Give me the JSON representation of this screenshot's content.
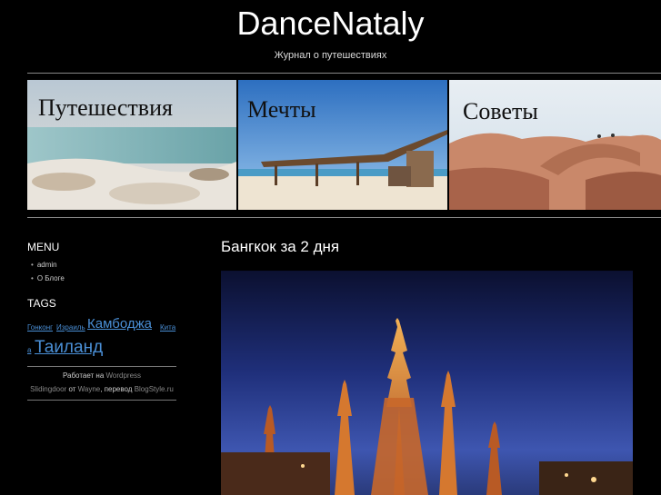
{
  "site": {
    "title": "DanceNataly",
    "tagline": "Журнал о путешествиях"
  },
  "banners": [
    {
      "label": "Путешествия"
    },
    {
      "label": "Мечты"
    },
    {
      "label": "Советы"
    }
  ],
  "sidebar": {
    "menu_heading": "MENU",
    "menu_items": [
      "admin",
      "О Блоге"
    ],
    "tags_heading": "TAGS",
    "tags": [
      "Гонконг",
      "Израиль",
      "Камбоджа",
      "Кита",
      "а",
      "Таиланд"
    ],
    "credits": {
      "powered_prefix": "Работает на",
      "powered_link": "Wordpress",
      "theme_link": "Slidingdoor",
      "from": "от",
      "author_link": "Wayne",
      "translation": ", перевод",
      "translator_link": "BlogStyle.ru"
    }
  },
  "post": {
    "title": "Бангкок за 2 дня"
  },
  "colors": {
    "background": "#000000",
    "tag_link": "#4a8fd6"
  }
}
